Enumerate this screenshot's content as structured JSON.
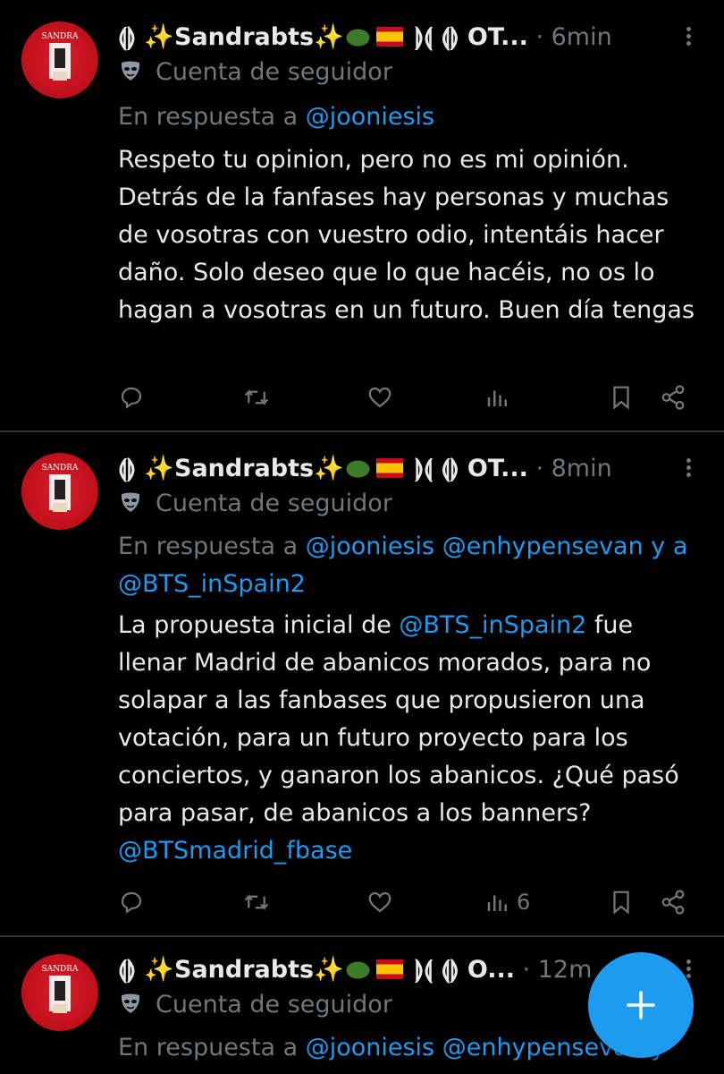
{
  "tweets": [
    {
      "display_name": "⟬⟭ ✨Sandrabts✨",
      "name_suffix": " ⟭⟬ ⟬⟭ OT...",
      "time": " · 6min",
      "badge": "Cuenta de seguidor",
      "reply_prefix": "En respuesta a ",
      "reply_mentions": [
        "@jooniesis"
      ],
      "reply_joiner": "",
      "body": "Respeto tu opinion, pero no es mi opinión. Detrás de la fanfases hay personas y muchas de vosotras con vuestro odio, intentáis hacer daño. Solo deseo que lo que hacéis, no os lo hagan a vosotras en un futuro. Buen día tengas",
      "views_count": ""
    },
    {
      "display_name": "⟬⟭ ✨Sandrabts✨",
      "name_suffix": " ⟭⟬ ⟬⟭ OT...",
      "time": " · 8min",
      "badge": "Cuenta de seguidor",
      "reply_prefix": "En respuesta a ",
      "reply_mentions": [
        "@jooniesis",
        "@enhypensevan",
        "@BTS_inSpain2"
      ],
      "reply_joiner": " y a ",
      "body_parts": [
        "La propuesta inicial de ",
        "@BTS_inSpain2",
        " fue llenar Madrid de abanicos morados, para no solapar a las fanbases que propusieron una votación, para un futuro proyecto para los conciertos, y ganaron los abanicos. ¿Qué pasó para pasar, de abanicos a los banners? ",
        "@BTSmadrid_fbase"
      ],
      "views_count": "6"
    },
    {
      "display_name": "⟬⟭ ✨Sandrabts✨",
      "name_suffix": " ⟭⟬ ⟬⟭ O...",
      "time": " · 12m",
      "badge": "Cuenta de seguidor",
      "reply_prefix": "En respuesta a ",
      "reply_mentions": [
        "@jooniesis",
        "@enhypensevan y"
      ]
    }
  ],
  "avatar_text": "SANDRA",
  "icons": {
    "reply": "reply-icon",
    "retweet": "retweet-icon",
    "like": "heart-icon",
    "views": "views-icon",
    "bookmark": "bookmark-icon",
    "share": "share-icon",
    "more": "more-icon",
    "compose": "plus-icon"
  },
  "colors": {
    "background": "#000000",
    "text": "#e7e9ea",
    "secondary": "#71767b",
    "accent": "#1d9bf0",
    "divider": "#2f3336"
  }
}
